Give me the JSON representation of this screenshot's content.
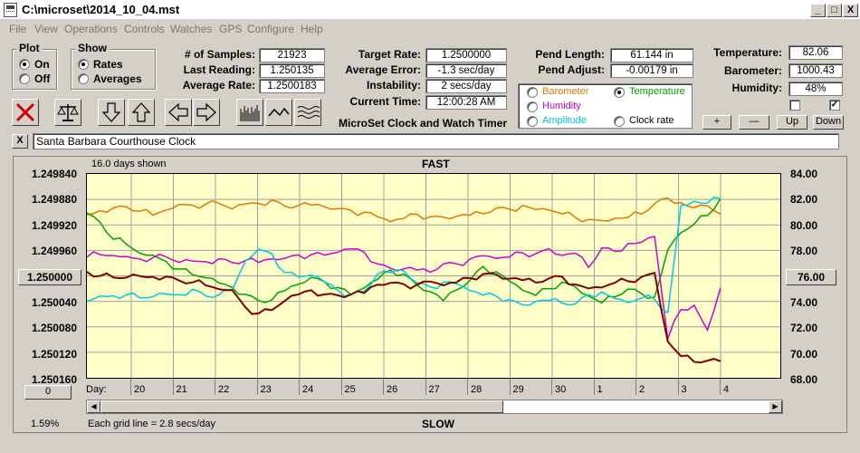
{
  "window": {
    "title": "C:\\microset\\2014_10_04.mst",
    "min": "_",
    "max": "□",
    "close": "X"
  },
  "menu": [
    "File",
    "View",
    "Operations",
    "Controls",
    "Watches",
    "GPS",
    "Configure",
    "Help"
  ],
  "plot_group": {
    "label": "Plot",
    "options": [
      "On",
      "Off"
    ],
    "selected": "On"
  },
  "show_group": {
    "label": "Show",
    "options": [
      "Rates",
      "Averages"
    ],
    "selected": "Rates"
  },
  "stats": {
    "samples_label": "# of Samples:",
    "samples": "21923",
    "last_label": "Last Reading:",
    "last": "1.250135",
    "avg_label": "Average Rate:",
    "avg": "1.2500183",
    "target_label": "Target Rate:",
    "target": "1.2500000",
    "avgerr_label": "Average Error:",
    "avgerr": "-1.3 sec/day",
    "instab_label": "Instability:",
    "instab": "2 secs/day",
    "time_label": "Current Time:",
    "time": "12:00:28 AM",
    "pendlen_label": "Pend Length:",
    "pendlen": "61.144 in",
    "pendadj_label": "Pend Adjust:",
    "pendadj": "-0.00179 in",
    "temp_label": "Temperature:",
    "temp": "82.06",
    "baro_label": "Barometer:",
    "baro": "1000.43",
    "hum_label": "Humidity:",
    "hum": "48%"
  },
  "app_caption": "MicroSet Clock and Watch Timer",
  "sensor_select": {
    "options": [
      {
        "label": "Barometer",
        "color": "#e07800",
        "selected": false
      },
      {
        "label": "Temperature",
        "color": "#00a000",
        "selected": true
      },
      {
        "label": "Humidity",
        "color": "#d000d0",
        "selected": false
      },
      {
        "label": "Amplitude",
        "color": "#00c8e8",
        "selected": false
      },
      {
        "label": "Clock rate",
        "color": "#000000",
        "selected": false
      }
    ]
  },
  "scale_buttons": {
    "plus": "+",
    "minus": "—",
    "up": "Up",
    "down": "Down"
  },
  "clock_name": "Santa Barbara Courthouse Clock",
  "clock_close": "X",
  "chart_header": {
    "days_shown": "16.0 days shown",
    "fast": "FAST",
    "slow": "SLOW",
    "grid_note": "Each grid line = 2.8 secs/day",
    "percent": "1.59%",
    "day_label": "Day:"
  },
  "left_center_button": "1.250000",
  "right_center_button": "76.00",
  "bottom_left_button": "0",
  "chart_data": {
    "type": "line",
    "x_ticks": [
      "20",
      "21",
      "22",
      "23",
      "24",
      "25",
      "26",
      "27",
      "28",
      "29",
      "30",
      "1",
      "2",
      "3",
      "4"
    ],
    "y_left_ticks": [
      "1.249840",
      "1.249880",
      "1.249920",
      "1.249960",
      "1.250040",
      "1.250080",
      "1.250120",
      "1.250160"
    ],
    "y_right_ticks": [
      "84.00",
      "82.00",
      "80.00",
      "78.00",
      "74.00",
      "72.00",
      "70.00",
      "68.00"
    ],
    "ylim_left": [
      1.25016,
      1.24984
    ],
    "ylim_right": [
      68,
      84
    ],
    "grid": true,
    "series": [
      {
        "color": "#e07800",
        "values": [
          80.8,
          81.0,
          81.2,
          81.4,
          81.2,
          80.9,
          81.2,
          81.5,
          81.4,
          81.6,
          81.8,
          81.4,
          81.7,
          81.6,
          81.8,
          81.4,
          81.6,
          81.7,
          81.5,
          81.2,
          81.0,
          80.9,
          80.7,
          80.4,
          80.6,
          80.8,
          80.5,
          80.5,
          80.7,
          80.9,
          81.0,
          81.3,
          81.1,
          81.4,
          81.2,
          81.3,
          81.0,
          80.6,
          80.3,
          80.2,
          80.5,
          80.7,
          81.0,
          81.7,
          82.0,
          81.6,
          81.3,
          81.6,
          81.0
        ]
      },
      {
        "color": "#00a000",
        "values": [
          80.8,
          80.2,
          79.0,
          78.6,
          77.8,
          77.5,
          77.0,
          76.5,
          76.2,
          76.0,
          75.5,
          75.0,
          74.4,
          74.0,
          74.2,
          75.0,
          75.4,
          75.8,
          75.4,
          75.0,
          74.6,
          75.2,
          75.8,
          76.4,
          76.0,
          75.2,
          74.8,
          74.2,
          75.0,
          75.6,
          76.6,
          76.2,
          75.6,
          75.0,
          74.6,
          75.0,
          75.4,
          75.0,
          74.4,
          74.0,
          74.5,
          75.0,
          74.5,
          74.2,
          78.0,
          79.5,
          80.2,
          80.8,
          82.0
        ]
      },
      {
        "color": "#d000d0",
        "values": [
          77.6,
          77.8,
          77.6,
          77.4,
          77.2,
          77.4,
          77.6,
          77.2,
          77.2,
          77.0,
          77.2,
          77.0,
          77.3,
          77.2,
          77.4,
          77.3,
          77.5,
          77.6,
          77.7,
          78.0,
          78.2,
          77.8,
          76.8,
          76.5,
          76.6,
          76.6,
          76.4,
          76.9,
          76.8,
          77.2,
          77.6,
          77.5,
          77.6,
          77.8,
          77.6,
          78.0,
          77.6,
          77.9,
          76.8,
          78.2,
          77.8,
          78.4,
          78.6,
          79.2,
          71.2,
          73.4,
          73.6,
          71.6,
          75.0
        ]
      },
      {
        "color": "#00c8e8",
        "values": [
          74.0,
          74.3,
          74.3,
          74.5,
          74.4,
          74.5,
          74.6,
          74.4,
          74.8,
          74.4,
          74.6,
          75.0,
          77.2,
          78.0,
          77.6,
          76.2,
          76.0,
          76.2,
          75.6,
          74.8,
          74.4,
          74.7,
          76.2,
          76.4,
          76.5,
          75.4,
          75.0,
          75.4,
          75.4,
          75.0,
          74.6,
          74.4,
          74.0,
          73.6,
          74.0,
          74.2,
          74.0,
          73.8,
          74.4,
          74.6,
          74.2,
          74.0,
          74.4,
          74.2,
          73.0,
          81.4,
          81.8,
          81.8,
          82.2
        ]
      },
      {
        "color": "#800000",
        "values": [
          76.2,
          76.0,
          76.0,
          76.0,
          76.0,
          75.8,
          75.8,
          75.6,
          75.6,
          75.4,
          75.0,
          74.8,
          73.4,
          73.0,
          73.4,
          74.2,
          74.6,
          74.8,
          74.4,
          74.4,
          74.6,
          74.8,
          75.4,
          75.4,
          75.2,
          75.2,
          75.6,
          75.4,
          75.6,
          75.8,
          76.0,
          76.0,
          75.8,
          75.8,
          75.6,
          75.8,
          75.8,
          75.2,
          75.0,
          75.2,
          75.6,
          75.6,
          75.8,
          76.1,
          70.8,
          69.8,
          69.4,
          69.4,
          69.2
        ]
      }
    ]
  }
}
